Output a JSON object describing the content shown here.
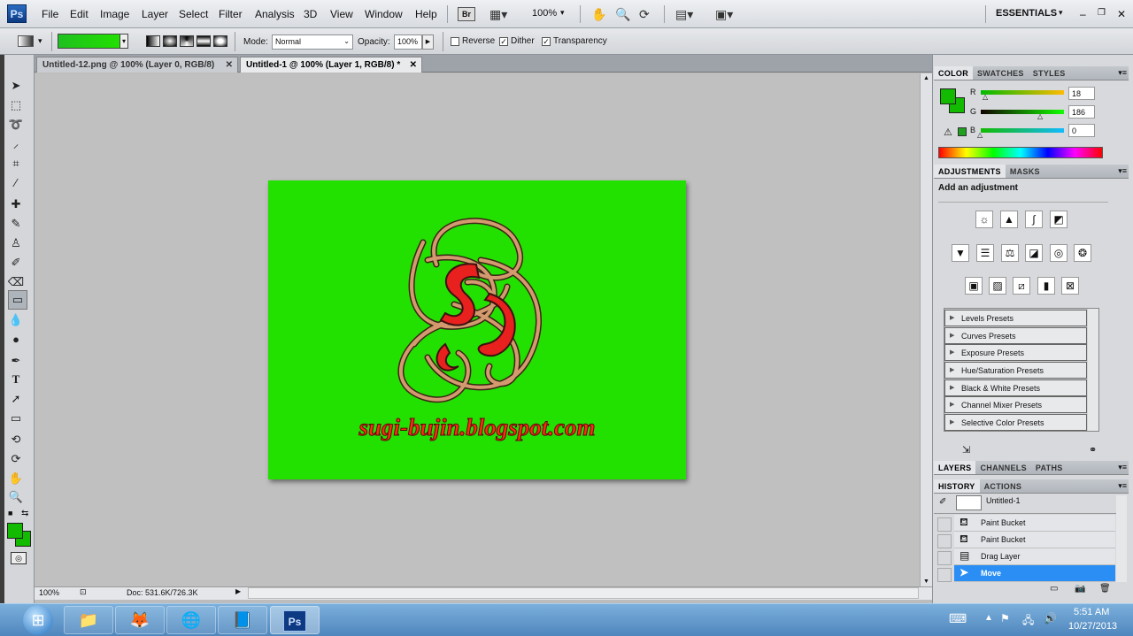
{
  "menubar": {
    "logo": "Ps",
    "items": [
      "File",
      "Edit",
      "Image",
      "Layer",
      "Select",
      "Filter",
      "Analysis",
      "3D",
      "View",
      "Window",
      "Help"
    ],
    "bridge_label": "Br",
    "zoom": "100%",
    "workspace": "ESSENTIALS"
  },
  "options": {
    "mode_label": "Mode:",
    "mode_value": "Normal",
    "opacity_label": "Opacity:",
    "opacity_value": "100%",
    "reverse_label": "Reverse",
    "dither_label": "Dither",
    "transparency_label": "Transparency",
    "gradient_color": "#1fc01f"
  },
  "tabs": [
    {
      "label": "Untitled-12.png @ 100% (Layer 0, RGB/8)"
    },
    {
      "label": "Untitled-1 @ 100% (Layer 1, RGB/8) *"
    }
  ],
  "document": {
    "background": "#22e000",
    "watermark": "sugi-bujin.blogspot.com"
  },
  "status": {
    "zoom": "100%",
    "doc": "Doc: 531.6K/726.3K"
  },
  "color_panel": {
    "tabs": [
      "COLOR",
      "SWATCHES",
      "STYLES"
    ],
    "r_label": "R",
    "g_label": "G",
    "b_label": "B",
    "r": "18",
    "g": "186",
    "b": "0",
    "foreground": "#12ba00"
  },
  "adjust_panel": {
    "tabs": [
      "ADJUSTMENTS",
      "MASKS"
    ],
    "heading": "Add an adjustment",
    "presets": [
      "Levels Presets",
      "Curves Presets",
      "Exposure Presets",
      "Hue/Saturation Presets",
      "Black & White Presets",
      "Channel Mixer Presets",
      "Selective Color Presets"
    ]
  },
  "layers_panel": {
    "tabs": [
      "LAYERS",
      "CHANNELS",
      "PATHS"
    ]
  },
  "history_panel": {
    "tabs": [
      "HISTORY",
      "ACTIONS"
    ],
    "snapshot": "Untitled-1",
    "items": [
      "Paint Bucket",
      "Paint Bucket",
      "Drag Layer",
      "Move"
    ]
  },
  "taskbar": {
    "time": "5:51 AM",
    "date": "10/27/2013",
    "ps_label": "Ps"
  }
}
